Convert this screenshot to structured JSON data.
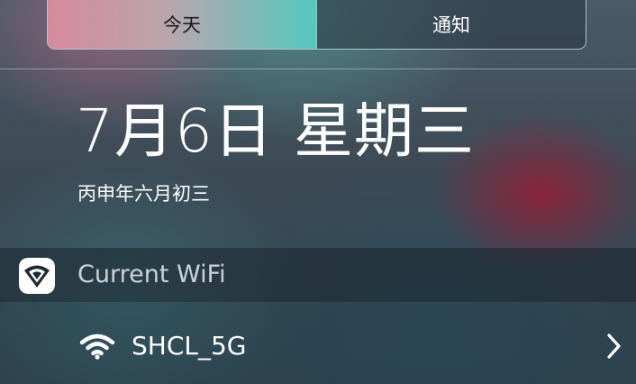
{
  "segmented_control": {
    "tabs": [
      {
        "label": "今天",
        "selected": true
      },
      {
        "label": "通知",
        "selected": false
      }
    ]
  },
  "date": {
    "main": "7月6日 星期三",
    "lunar": "丙申年六月初三"
  },
  "widget": {
    "title": "Current WiFi",
    "app_icon": "wifi-shield-icon",
    "network": {
      "icon": "wifi-icon",
      "name": "SHCL_5G",
      "disclosure_icon": "chevron-right-icon"
    }
  },
  "colors": {
    "active_tab_gradient_start": "#d68a9e",
    "active_tab_gradient_end": "#55c8c0",
    "text": "#ffffff"
  }
}
